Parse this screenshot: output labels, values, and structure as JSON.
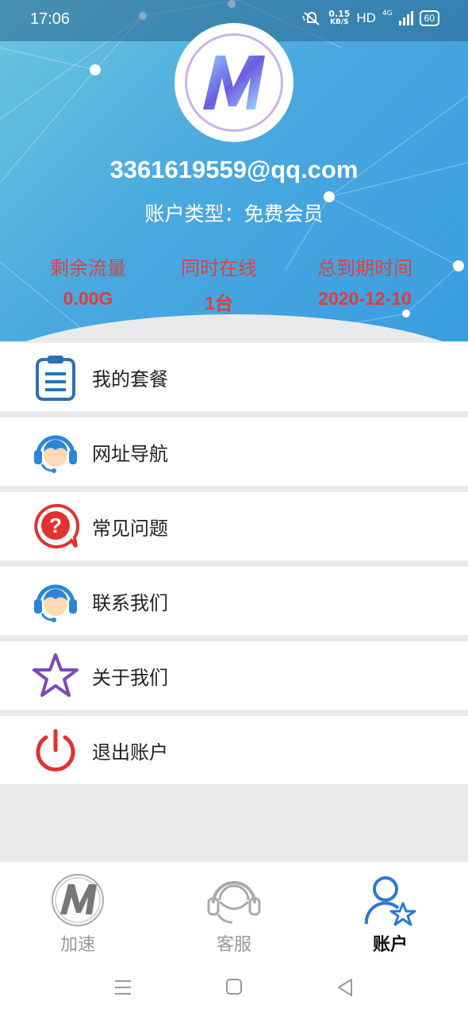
{
  "status_bar": {
    "time": "17:06",
    "speed_value": "0.15",
    "speed_unit": "KB/S",
    "hd": "HD",
    "network": "4G",
    "battery": "60"
  },
  "account": {
    "email": "3361619559@qq.com",
    "type_label": "账户类型：免费会员"
  },
  "stats": [
    {
      "label": "剩余流量",
      "value": "0.00G"
    },
    {
      "label": "同时在线",
      "value": "1台"
    },
    {
      "label": "总到期时间",
      "value": "2020-12-10"
    }
  ],
  "menu": [
    {
      "label": "我的套餐",
      "icon": "clipboard-icon"
    },
    {
      "label": "网址导航",
      "icon": "headset-icon"
    },
    {
      "label": "常见问题",
      "icon": "question-icon"
    },
    {
      "label": "联系我们",
      "icon": "headset-icon"
    },
    {
      "label": "关于我们",
      "icon": "star-icon"
    },
    {
      "label": "退出账户",
      "icon": "power-icon"
    }
  ],
  "bottom_nav": [
    {
      "label": "加速",
      "icon": "logo-m-icon",
      "active": false
    },
    {
      "label": "客服",
      "icon": "headset-icon",
      "active": false
    },
    {
      "label": "账户",
      "icon": "user-star-icon",
      "active": true
    }
  ],
  "colors": {
    "stat_text": "#e23b3b",
    "accent_blue": "#2b78d4"
  }
}
